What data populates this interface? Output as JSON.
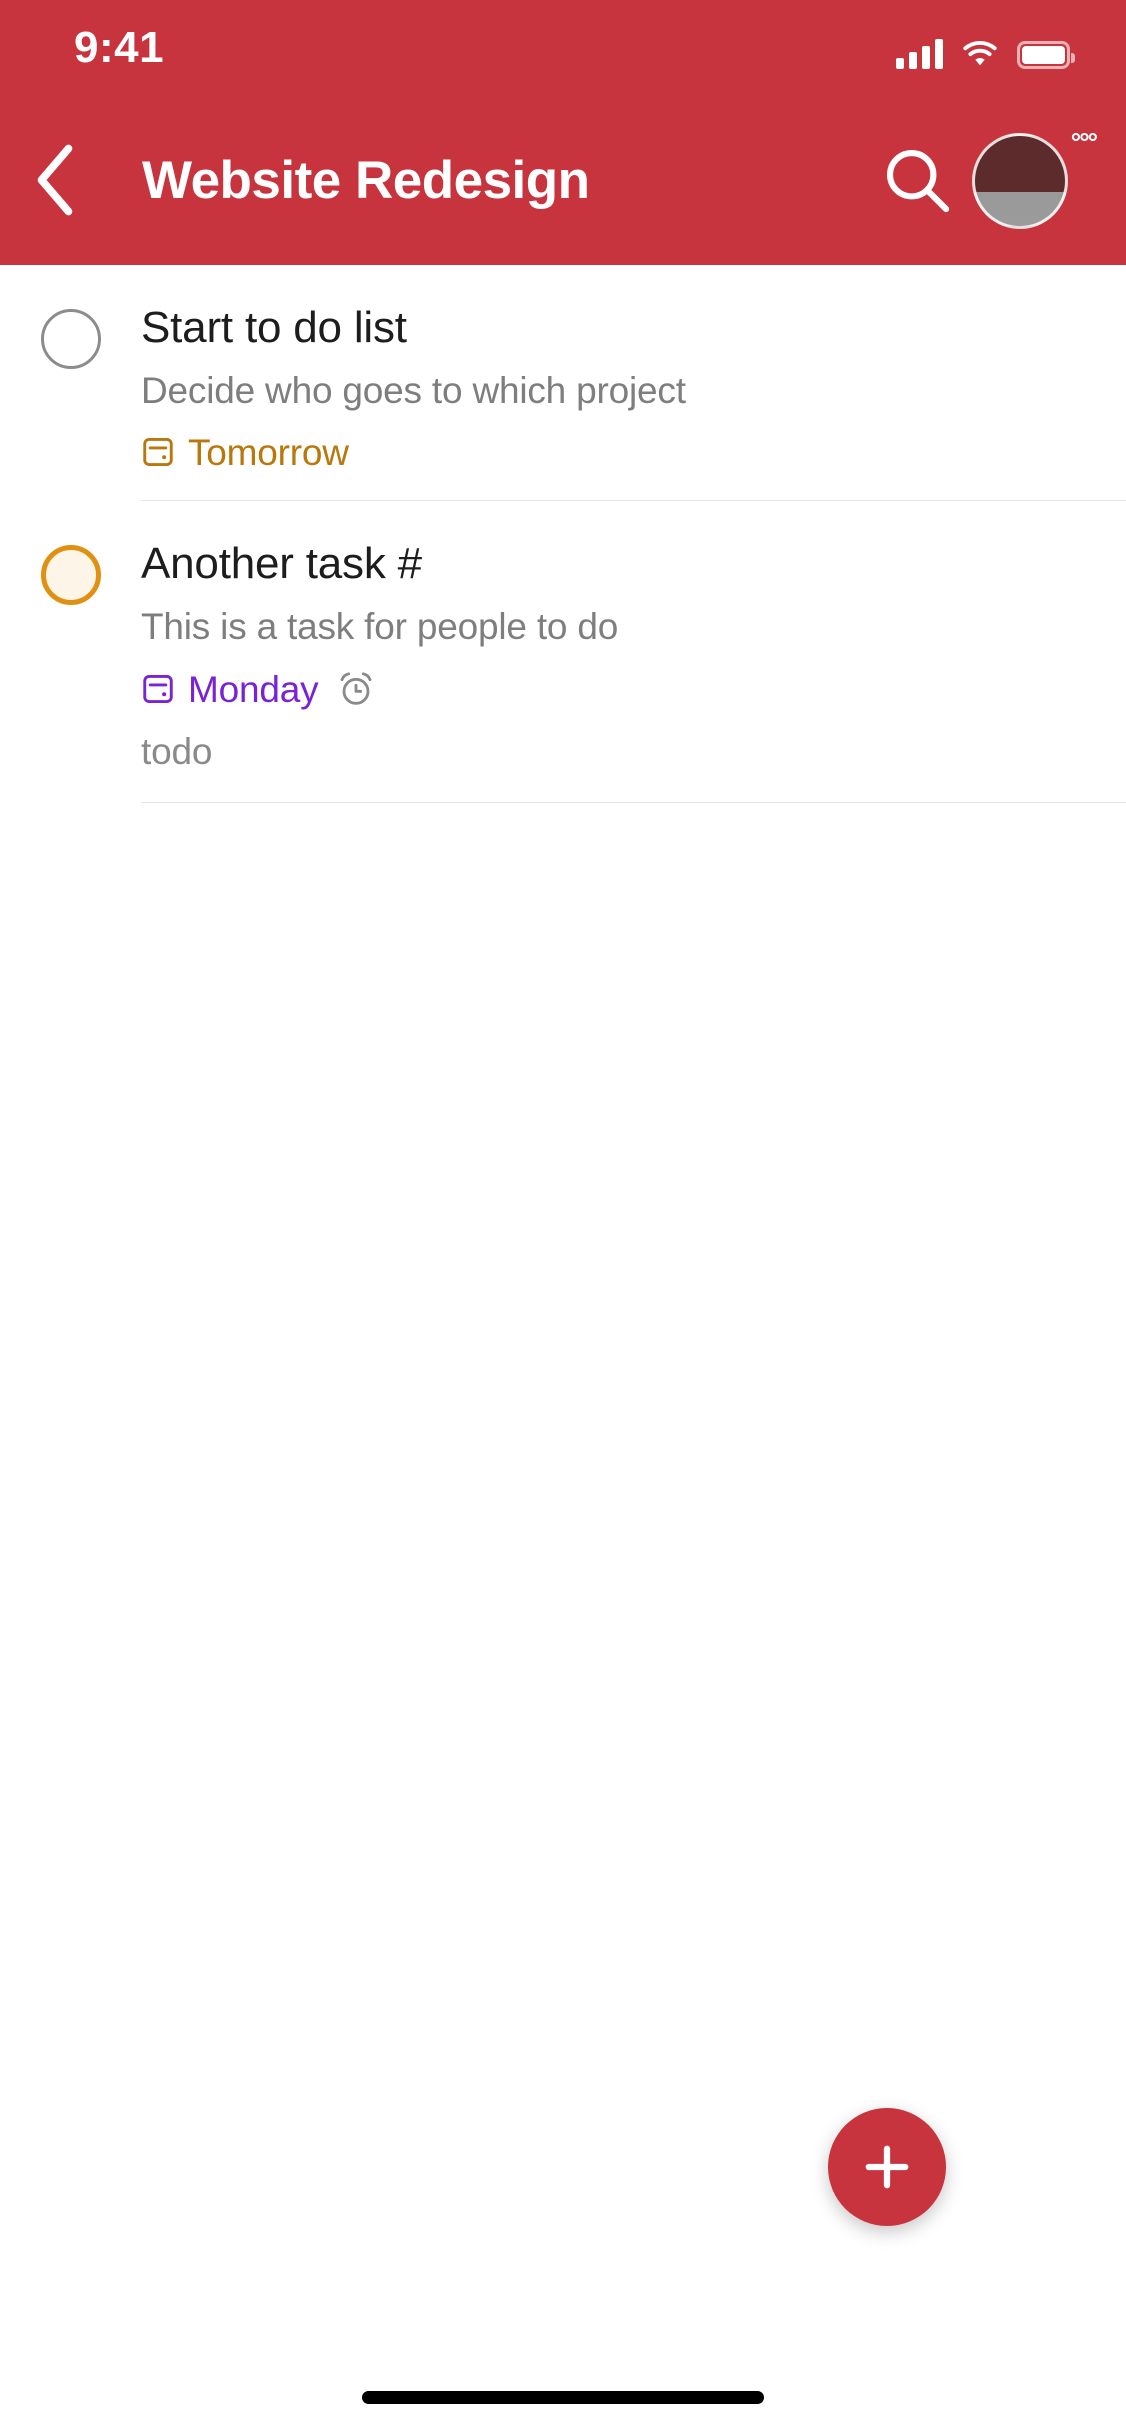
{
  "status_bar": {
    "time": "9:41",
    "signal_icon": "cellular-bars-icon",
    "wifi_icon": "wifi-icon",
    "battery_icon": "battery-full-icon"
  },
  "app_bar": {
    "back_icon": "chevron-left-icon",
    "title": "Website Redesign",
    "search_icon": "search-icon",
    "avatar_icon": "avatar",
    "avatar_badge": "°°°",
    "background_color": "#c8343e"
  },
  "tasks": [
    {
      "checkbox_state": "unchecked",
      "checkbox_color": "#8c8c8c",
      "title": "Start to do list",
      "description": "Decide who goes to which project",
      "date_icon": "calendar-note-icon",
      "date_label": "Tomorrow",
      "date_color": "#b8780c",
      "has_reminder": false,
      "tag": ""
    },
    {
      "checkbox_state": "unchecked-priority",
      "checkbox_color": "#e09113",
      "title": "Another task #",
      "description": "This is a task for people to do",
      "date_icon": "calendar-note-icon",
      "date_label": "Monday",
      "date_color": "#7a22d6",
      "has_reminder": true,
      "reminder_icon": "alarm-clock-icon",
      "tag": "todo"
    }
  ],
  "fab": {
    "icon": "plus-icon",
    "label": "+",
    "color": "#c8343e"
  },
  "home_indicator": "home-indicator"
}
